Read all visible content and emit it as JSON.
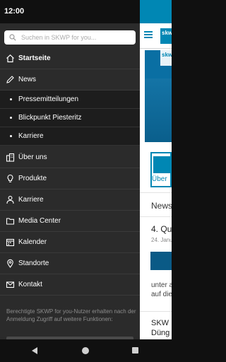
{
  "status_bar": {
    "time": "12:00"
  },
  "search": {
    "placeholder": "Suchen in SKWP for you..."
  },
  "nav": {
    "items": [
      {
        "label": "Startseite",
        "icon": "home-icon",
        "active": true
      },
      {
        "label": "News",
        "icon": "pencil-icon",
        "active": false
      },
      {
        "label": "Über uns",
        "icon": "building-icon",
        "active": false
      },
      {
        "label": "Produkte",
        "icon": "lightbulb-icon",
        "active": false
      },
      {
        "label": "Karriere",
        "icon": "person-icon",
        "active": false
      },
      {
        "label": "Media Center",
        "icon": "folder-icon",
        "active": false
      },
      {
        "label": "Kalender",
        "icon": "calendar-icon",
        "active": false
      },
      {
        "label": "Standorte",
        "icon": "map-pin-icon",
        "active": false
      },
      {
        "label": "Kontakt",
        "icon": "envelope-icon",
        "active": false
      }
    ],
    "news_subitems": [
      {
        "label": "Pressemitteilungen"
      },
      {
        "label": "Blickpunkt Piesteritz"
      },
      {
        "label": "Karriere"
      }
    ]
  },
  "info": {
    "text": "Berechtigte SKWP for you-Nutzer erhalten nach der Anmeldung Zugriff auf weitere Funktionen:"
  },
  "background_app": {
    "logo_text": "skw",
    "hero_logo_text": "skw",
    "tile_label": "Über",
    "news_heading": "News",
    "article1_title": "4. Qu",
    "article1_date": "24. Janu",
    "article1_body_1": "unter a",
    "article1_body_2": "auf die",
    "article2_title_1": "SKW",
    "article2_title_2": "Düng"
  },
  "colors": {
    "drawer_bg": "#2b2b2b",
    "submenu_bg": "#1d1d1d",
    "brand": "#0087b4"
  }
}
